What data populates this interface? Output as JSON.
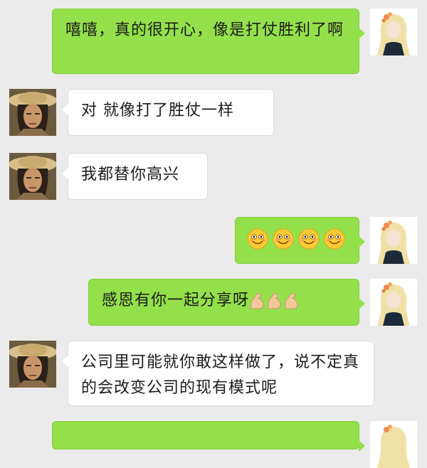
{
  "messages": [
    {
      "side": "right",
      "text": "嘻嘻，真的很开心，像是打仗胜利了啊"
    },
    {
      "side": "left",
      "text": "对 就像打了胜仗一样"
    },
    {
      "side": "left",
      "text": "我都替你高兴"
    },
    {
      "side": "right",
      "emoji": [
        "grinning-face-emoji",
        "grinning-face-emoji",
        "grinning-face-emoji",
        "grinning-face-emoji"
      ]
    },
    {
      "side": "right",
      "text": "感恩有你一起分享呀",
      "emoji": [
        "flexed-biceps-emoji",
        "flexed-biceps-emoji",
        "flexed-biceps-emoji"
      ]
    },
    {
      "side": "left",
      "text": "公司里可能就你敢这样做了，说不定真的会改变公司的现有模式呢"
    }
  ],
  "avatars": {
    "left": "man-with-straw-hat-avatar",
    "right": "blonde-woman-avatar"
  },
  "colors": {
    "background": "#ebebeb",
    "sent_bubble": "#94e04a",
    "received_bubble": "#ffffff"
  }
}
